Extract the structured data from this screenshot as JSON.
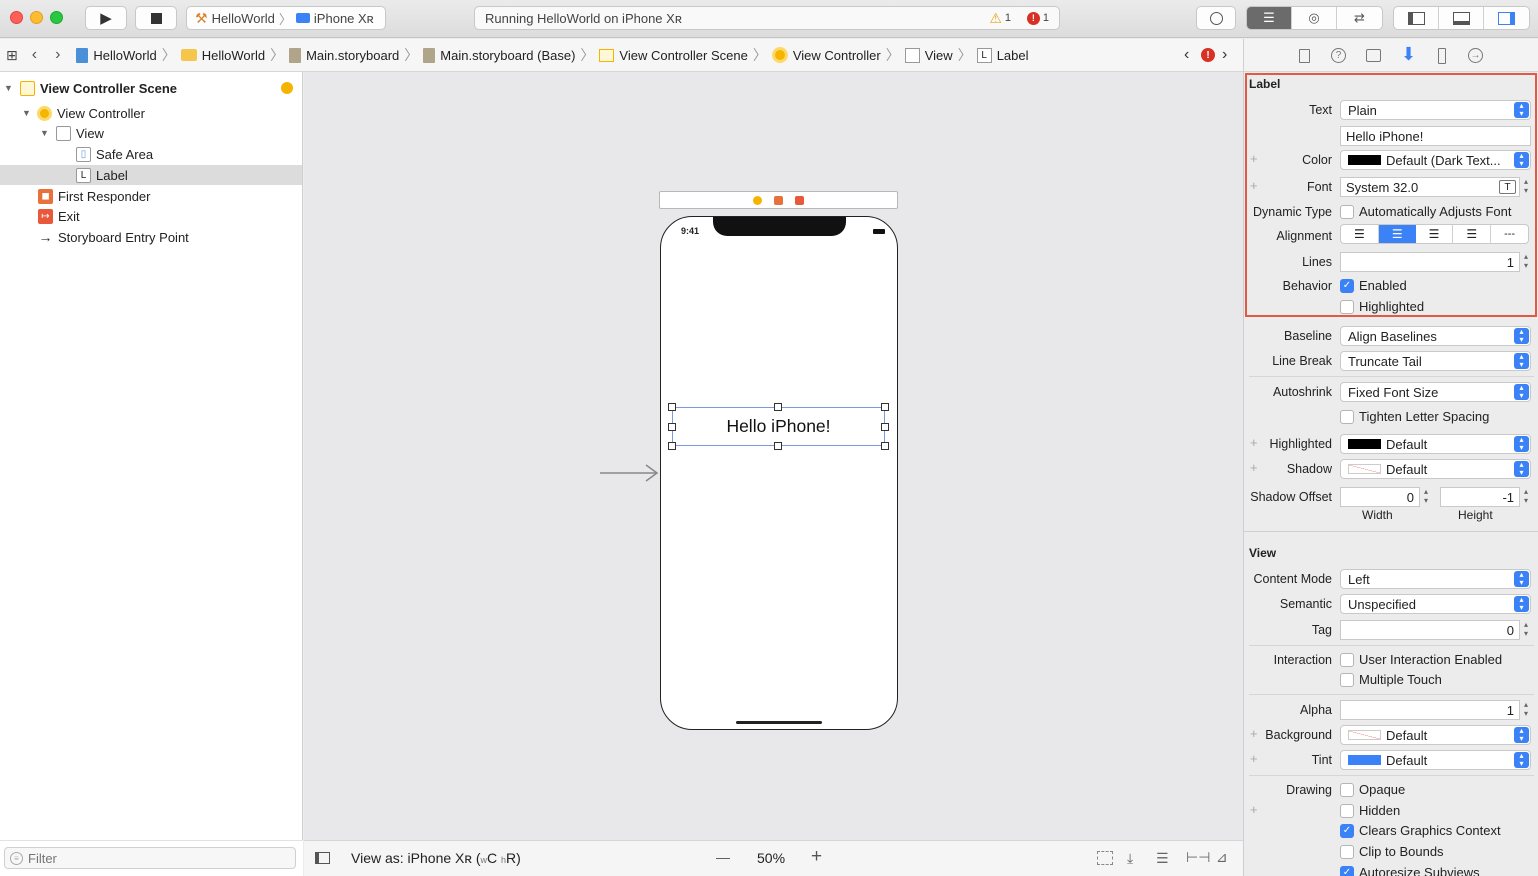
{
  "toolbar": {
    "scheme": "HelloWorld",
    "destination": "iPhone Xʀ",
    "status": "Running HelloWorld on iPhone Xʀ",
    "warning_count": "1",
    "error_count": "1"
  },
  "jumpbar": {
    "crumbs": [
      "HelloWorld",
      "HelloWorld",
      "Main.storyboard",
      "Main.storyboard (Base)",
      "View Controller Scene",
      "View Controller",
      "View",
      "Label"
    ]
  },
  "navigator": {
    "items": [
      {
        "label": "View Controller Scene"
      },
      {
        "label": "View Controller"
      },
      {
        "label": "View"
      },
      {
        "label": "Safe Area"
      },
      {
        "label": "Label"
      },
      {
        "label": "First Responder"
      },
      {
        "label": "Exit"
      },
      {
        "label": "Storyboard Entry Point"
      }
    ],
    "filter_placeholder": "Filter"
  },
  "canvas": {
    "status_time": "9:41",
    "label_text": "Hello iPhone!"
  },
  "bottombar": {
    "view_as": "View as: iPhone Xʀ (",
    "size_w": "w",
    "size_c": "C",
    "size_h": "h",
    "size_r": "R)",
    "zoom_out": "—",
    "zoom": "50%",
    "zoom_in": "+"
  },
  "inspector": {
    "label_section": {
      "title": "Label",
      "text_label": "Text",
      "text_value": "Plain",
      "text_content": "Hello iPhone!",
      "color_label": "Color",
      "color_value": "Default (Dark Text...",
      "font_label": "Font",
      "font_value": "System 32.0",
      "dynamic_label": "Dynamic Type",
      "dynamic_value": "Automatically Adjusts Font",
      "alignment_label": "Alignment",
      "lines_label": "Lines",
      "lines_value": "1",
      "behavior_label": "Behavior",
      "enabled": "Enabled",
      "highlighted": "Highlighted",
      "baseline_label": "Baseline",
      "baseline_value": "Align Baselines",
      "linebreak_label": "Line Break",
      "linebreak_value": "Truncate Tail",
      "autoshrink_label": "Autoshrink",
      "autoshrink_value": "Fixed Font Size",
      "tighten": "Tighten Letter Spacing",
      "highlighted_label": "Highlighted",
      "highlighted_value": "Default",
      "shadow_label": "Shadow",
      "shadow_value": "Default",
      "shadow_offset_label": "Shadow Offset",
      "shadow_width": "0",
      "shadow_height": "-1",
      "width_caption": "Width",
      "height_caption": "Height"
    },
    "view_section": {
      "title": "View",
      "content_mode_label": "Content Mode",
      "content_mode_value": "Left",
      "semantic_label": "Semantic",
      "semantic_value": "Unspecified",
      "tag_label": "Tag",
      "tag_value": "0",
      "interaction_label": "Interaction",
      "user_interaction": "User Interaction Enabled",
      "multiple_touch": "Multiple Touch",
      "alpha_label": "Alpha",
      "alpha_value": "1",
      "background_label": "Background",
      "background_value": "Default",
      "tint_label": "Tint",
      "tint_value": "Default",
      "drawing_label": "Drawing",
      "opaque": "Opaque",
      "hidden": "Hidden",
      "clears": "Clears Graphics Context",
      "clip": "Clip to Bounds",
      "autoresize": "Autoresize Subviews"
    }
  },
  "colors": {
    "accent": "#3b82f6",
    "highlight_border": "#e05a45",
    "close": "#fe5f57",
    "minimize": "#febc2e",
    "zoom": "#28c840"
  }
}
